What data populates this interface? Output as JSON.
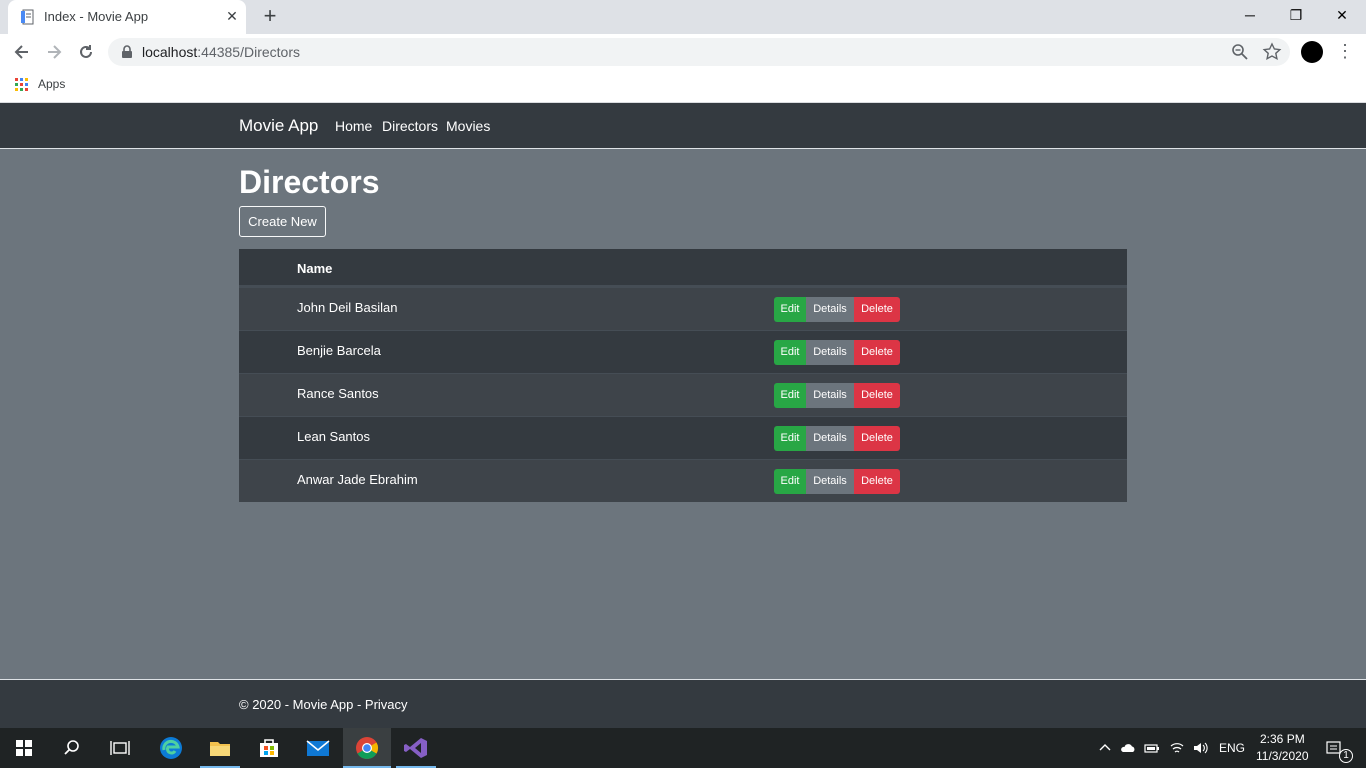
{
  "browser": {
    "tab_title": "Index - Movie App",
    "tab_close": "✕",
    "new_tab": "+",
    "url_host": "localhost",
    "url_port_path": ":44385/Directors",
    "bookmarks_apps": "Apps",
    "window_controls": {
      "minimize": "─",
      "restore": "❐",
      "close": "✕"
    },
    "menu": "⋮"
  },
  "site": {
    "brand": "Movie App",
    "nav": [
      {
        "label": "Home"
      },
      {
        "label": "Directors"
      },
      {
        "label": "Movies"
      }
    ]
  },
  "page": {
    "title": "Directors",
    "create_label": "Create New",
    "table": {
      "header_name": "Name",
      "rows": [
        {
          "name": "John Deil Basilan",
          "edit": "Edit",
          "details": "Details",
          "delete": "Delete"
        },
        {
          "name": "Benjie Barcela",
          "edit": "Edit",
          "details": "Details",
          "delete": "Delete"
        },
        {
          "name": "Rance Santos",
          "edit": "Edit",
          "details": "Details",
          "delete": "Delete"
        },
        {
          "name": "Lean Santos",
          "edit": "Edit",
          "details": "Details",
          "delete": "Delete"
        },
        {
          "name": "Anwar Jade Ebrahim",
          "edit": "Edit",
          "details": "Details",
          "delete": "Delete"
        }
      ]
    }
  },
  "footer": {
    "copyright": "© 2020 - Movie App - ",
    "privacy": "Privacy"
  },
  "taskbar": {
    "language": "ENG",
    "time": "2:36 PM",
    "date": "11/3/2020",
    "notification_count": "1"
  },
  "colors": {
    "page_bg": "#6c757d",
    "navbar_bg": "#343a40",
    "edit": "#28a745",
    "details": "#6c757d",
    "delete": "#dc3545"
  }
}
